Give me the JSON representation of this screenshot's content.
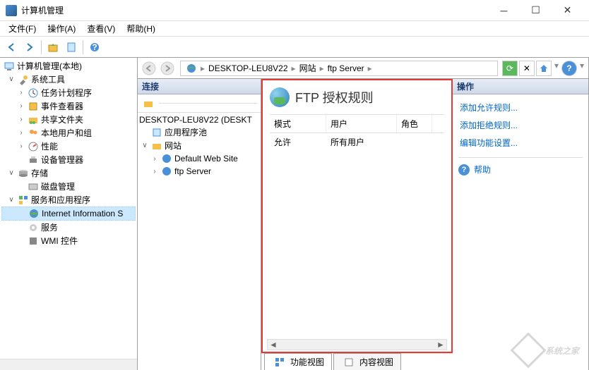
{
  "window": {
    "title": "计算机管理"
  },
  "menubar": {
    "file": "文件(F)",
    "action": "操作(A)",
    "view": "查看(V)",
    "help": "帮助(H)"
  },
  "left_tree": {
    "root": "计算机管理(本地)",
    "system_tools": "系统工具",
    "task_scheduler": "任务计划程序",
    "event_viewer": "事件查看器",
    "shared_folders": "共享文件夹",
    "local_users": "本地用户和组",
    "performance": "性能",
    "device_manager": "设备管理器",
    "storage": "存储",
    "disk_management": "磁盘管理",
    "services_apps": "服务和应用程序",
    "iis": "Internet Information S",
    "services": "服务",
    "wmi": "WMI 控件"
  },
  "breadcrumb": {
    "seg1": "DESKTOP-LEU8V22",
    "seg2": "网站",
    "seg3": "ftp Server"
  },
  "connections": {
    "header": "连接",
    "root": "DESKTOP-LEU8V22 (DESKT",
    "app_pools": "应用程序池",
    "sites": "网站",
    "default_site": "Default Web Site",
    "ftp_server": "ftp Server"
  },
  "feature": {
    "title": "FTP 授权规则",
    "col_mode": "模式",
    "col_user": "用户",
    "col_role": "角色",
    "row1_mode": "允许",
    "row1_user": "所有用户"
  },
  "tabs": {
    "features": "功能视图",
    "content": "内容视图"
  },
  "actions": {
    "header": "操作",
    "add_allow": "添加允许规则...",
    "add_deny": "添加拒绝规则...",
    "edit_feature": "编辑功能设置...",
    "help": "帮助"
  },
  "watermark": "系统之家"
}
